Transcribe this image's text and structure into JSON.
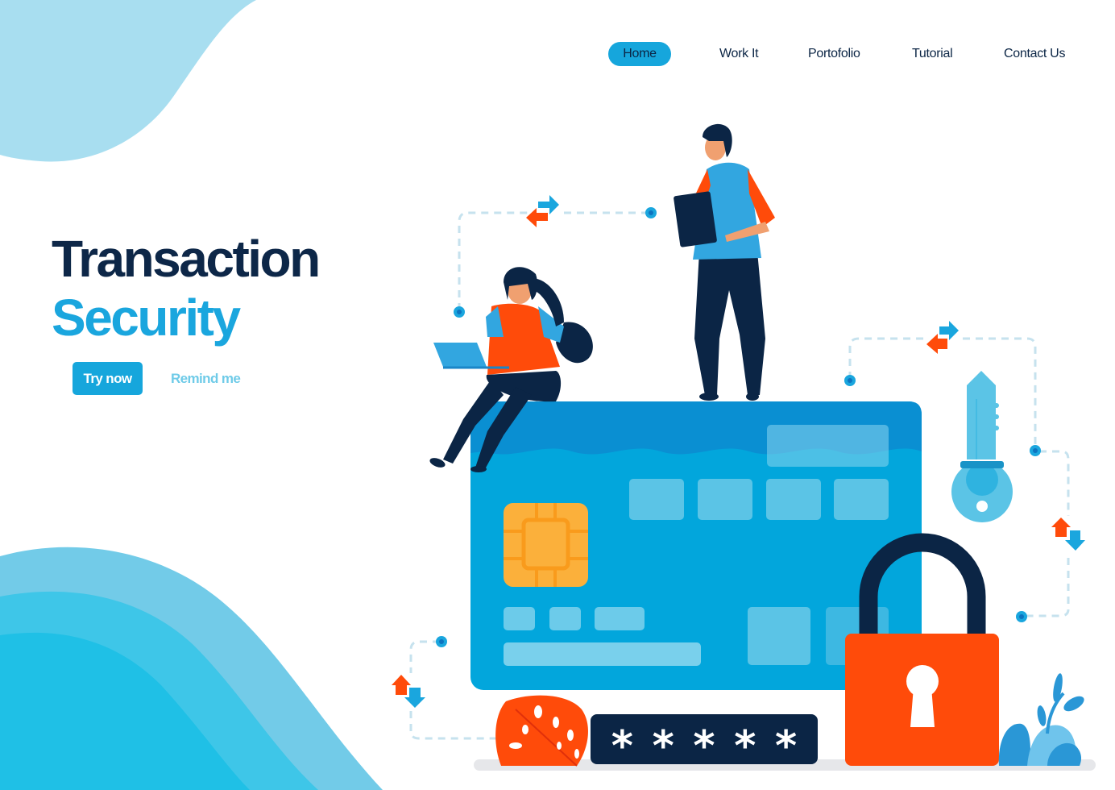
{
  "nav": {
    "items": [
      {
        "label": "Home",
        "active": true
      },
      {
        "label": "Work It",
        "active": false
      },
      {
        "label": "Portofolio",
        "active": false
      },
      {
        "label": "Tutorial",
        "active": false
      },
      {
        "label": "Contact Us",
        "active": false
      }
    ]
  },
  "hero": {
    "title_line1": "Transaction",
    "title_line2": "Security",
    "primary_button": "Try now",
    "secondary_button": "Remind me"
  },
  "illustration": {
    "password_mask": [
      "*",
      "*",
      "*",
      "*",
      "*"
    ],
    "icons": [
      "credit-card",
      "padlock",
      "key",
      "laptop",
      "tablet",
      "transfer-arrows",
      "leaf",
      "plant"
    ]
  },
  "colors": {
    "primary": "#16a6dc",
    "navy": "#0b2545",
    "orange": "#ff4b0a",
    "chip": "#fbb03b",
    "light_blue": "#a8def0"
  }
}
